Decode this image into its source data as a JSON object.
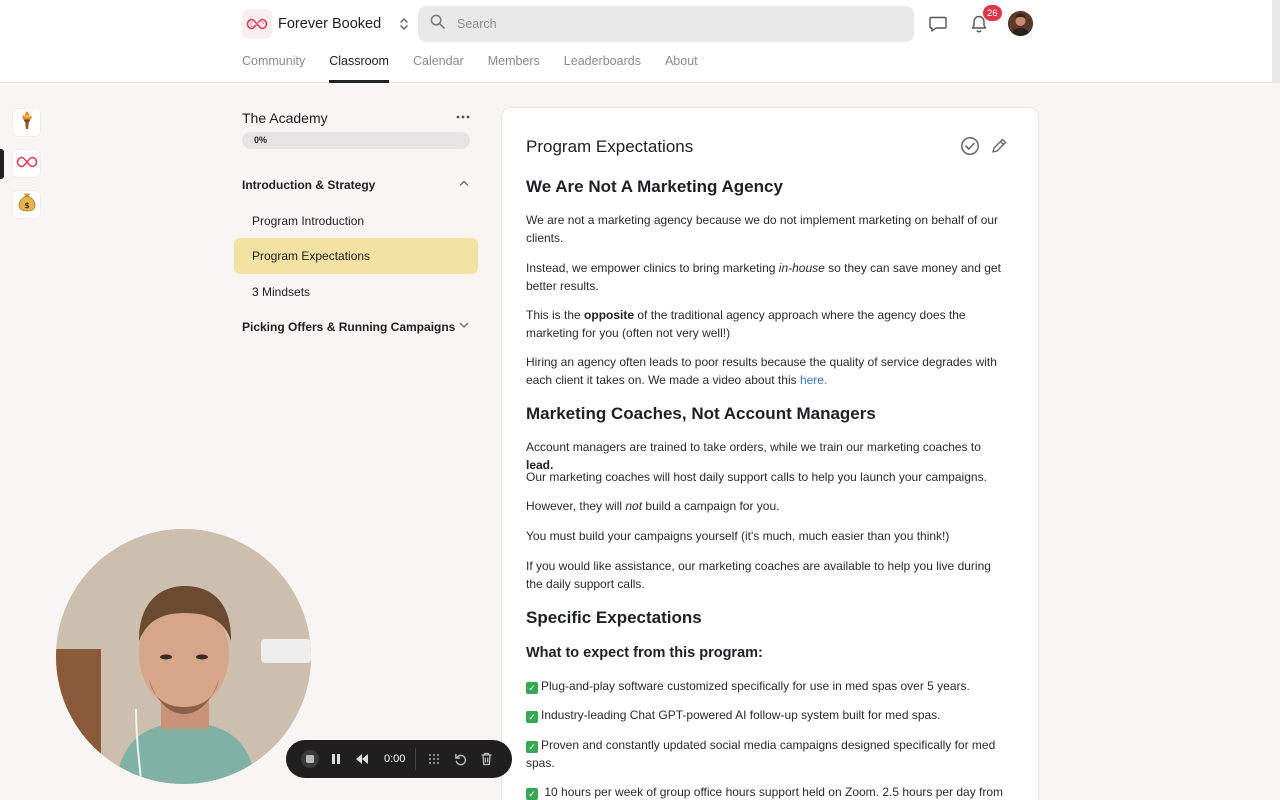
{
  "header": {
    "brand_name": "Forever Booked",
    "search_placeholder": "Search",
    "notifications_count": "26",
    "tabs": [
      {
        "label": "Community"
      },
      {
        "label": "Classroom"
      },
      {
        "label": "Calendar"
      },
      {
        "label": "Members"
      },
      {
        "label": "Leaderboards"
      },
      {
        "label": "About"
      }
    ],
    "active_tab": "Classroom"
  },
  "rail": {
    "items": [
      {
        "icon": "torch-icon"
      },
      {
        "icon": "infinity-logo-icon"
      },
      {
        "icon": "money-bag-icon"
      }
    ]
  },
  "course": {
    "title": "The Academy",
    "progress": 0,
    "progress_label": "0%",
    "sections": [
      {
        "title": "Introduction & Strategy",
        "expanded": true
      },
      {
        "title": "Picking Offers & Running Campaigns",
        "expanded": false
      }
    ],
    "lessons": [
      {
        "label": "Program Introduction"
      },
      {
        "label": "Program Expectations"
      },
      {
        "label": "3 Mindsets"
      }
    ],
    "active_lesson": "Program Expectations"
  },
  "lesson": {
    "title": "Program Expectations",
    "h_agency": "We Are Not A Marketing Agency",
    "p1": "We are not a marketing agency because we do not implement marketing on behalf of our clients.",
    "p2_before": "Instead, we empower clinics to bring marketing ",
    "p2_em": "in-house",
    "p2_after": " so they can save money and get better results.",
    "p3_before": "This is the ",
    "p3_bold": "opposite",
    "p3_after": " of the traditional agency approach where the agency does the marketing for you (often not very well!)",
    "p4_before": "Hiring an agency often leads to poor results because the quality of service degrades with each client it takes on. We made a video about this ",
    "p4_link": "here.",
    "h_coaches": "Marketing Coaches, Not Account Managers",
    "p5_before": "Account managers are trained to take orders, while we train our marketing coaches to ",
    "p5_bold": "lead.",
    "p6": "Our marketing coaches will host daily support calls to help you launch your campaigns.",
    "p7_before": "However, they will ",
    "p7_em": "not",
    "p7_after": " build a campaign for you.",
    "p8": "You must build your campaigns yourself (it's much, much easier than you think!)",
    "p9": "If you would like assistance, our marketing coaches are available to help you live during the daily support calls.",
    "h_specific": "Specific Expectations",
    "h_what": "What to expect from this program:",
    "check_items": [
      "Plug-and-play software customized specifically for use in med spas over 5 years.",
      "Industry-leading Chat GPT-powered AI follow-up system built for med spas.",
      "Proven and constantly updated social media campaigns designed specifically for med spas.",
      "10 hours per week of group office hours support held on Zoom. 2.5 hours per day from"
    ]
  },
  "recorder": {
    "time": "0:00"
  },
  "colors": {
    "active_lesson_bg": "#f4e2a2",
    "badge": "#e0364a",
    "link": "#3b73c8",
    "check": "#3aa757"
  }
}
